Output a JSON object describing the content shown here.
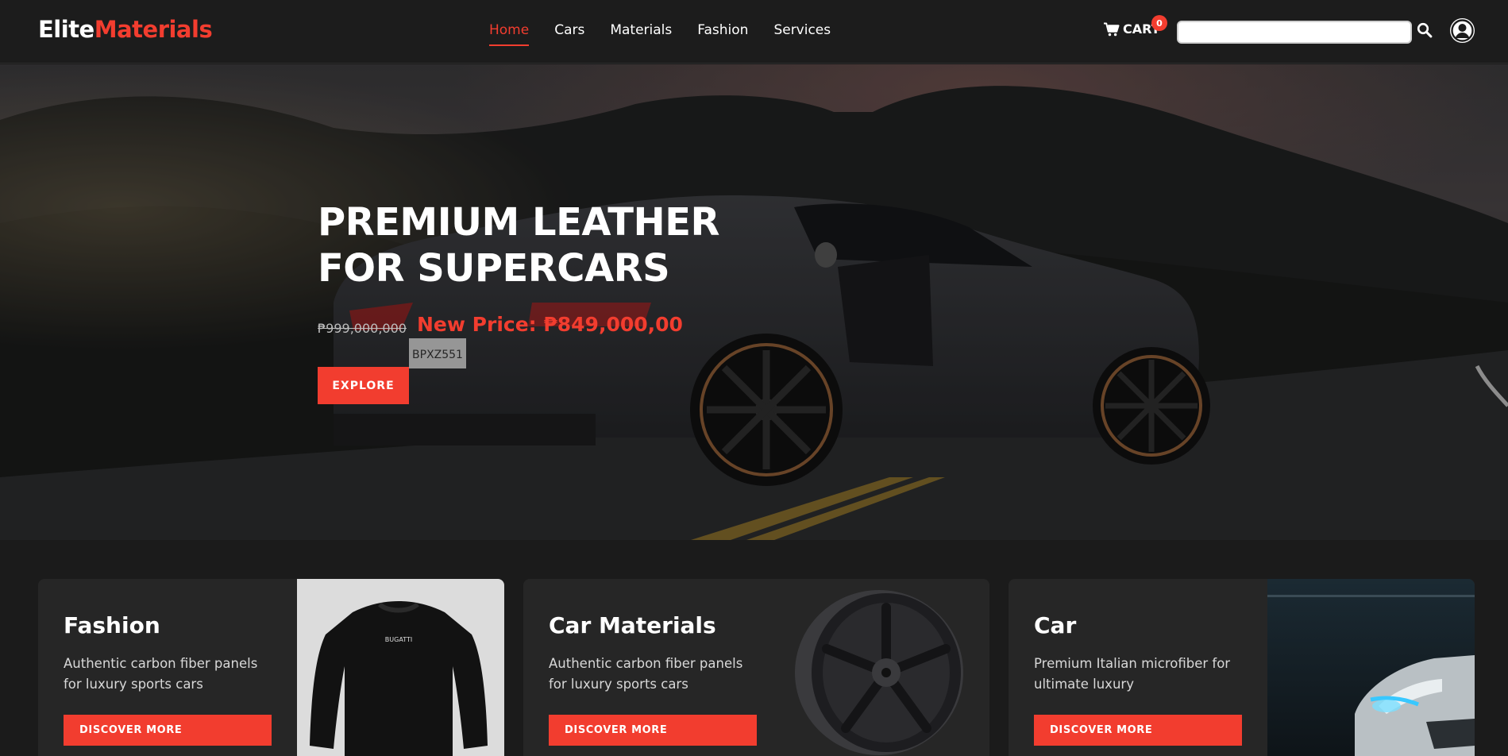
{
  "brand": {
    "part1": "Elite",
    "part2": "Materials"
  },
  "nav": {
    "links": [
      {
        "label": "Home",
        "active": true
      },
      {
        "label": "Cars"
      },
      {
        "label": "Materials"
      },
      {
        "label": "Fashion"
      },
      {
        "label": "Services"
      }
    ],
    "cart": {
      "label": "CART",
      "count": "0",
      "icon": "cart-icon"
    },
    "search": {
      "value": "",
      "icon": "search-icon"
    },
    "account_icon": "user-avatar-icon"
  },
  "hero": {
    "title_line1": "PREMIUM LEATHER",
    "title_line2": "FOR SUPERCARS",
    "old_price": "₱999,000,000",
    "new_price": "New Price: ₱849,000,00",
    "button": "EXPLORE"
  },
  "cards": [
    {
      "title": "Fashion",
      "description": "Authentic carbon fiber panels for luxury sports cars",
      "button": "DISCOVER MORE",
      "image": "sweatshirt-image"
    },
    {
      "title": "Car Materials",
      "description": "Authentic carbon fiber panels for luxury sports cars",
      "button": "DISCOVER MORE",
      "image": "wheel-rim-image"
    },
    {
      "title": "Car",
      "description": "Premium Italian microfiber for ultimate luxury",
      "button": "DISCOVER MORE",
      "image": "car-headlight-image"
    }
  ],
  "sweatshirt_print": "BUGATTI",
  "hero_car_plate": "BPXZ551",
  "colors": {
    "accent": "#f23d2f",
    "background": "#1b1b1b",
    "card": "#262626",
    "nav": "#1c1c1c"
  }
}
